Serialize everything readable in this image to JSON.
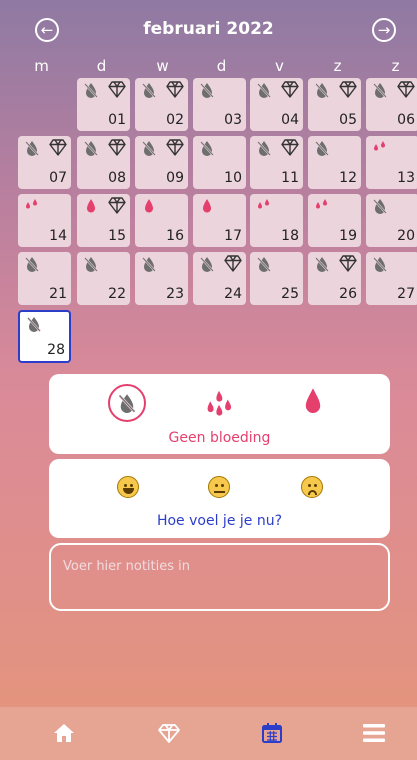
{
  "header": {
    "title": "februari 2022"
  },
  "weekdays": [
    "m",
    "d",
    "w",
    "d",
    "v",
    "z",
    "z"
  ],
  "cells": [
    {
      "day": "01",
      "b": "none",
      "d": true
    },
    {
      "day": "02",
      "b": "none",
      "d": true
    },
    {
      "day": "03",
      "b": "none",
      "d": false
    },
    {
      "day": "04",
      "b": "none",
      "d": true
    },
    {
      "day": "05",
      "b": "none",
      "d": true
    },
    {
      "day": "06",
      "b": "none",
      "d": true
    },
    {
      "day": "07",
      "b": "none",
      "d": true
    },
    {
      "day": "08",
      "b": "none",
      "d": true
    },
    {
      "day": "09",
      "b": "none",
      "d": true
    },
    {
      "day": "10",
      "b": "none",
      "d": false
    },
    {
      "day": "11",
      "b": "none",
      "d": true
    },
    {
      "day": "12",
      "b": "none",
      "d": false
    },
    {
      "day": "13",
      "b": "light",
      "d": false
    },
    {
      "day": "14",
      "b": "light",
      "d": false
    },
    {
      "day": "15",
      "b": "heavy",
      "d": true
    },
    {
      "day": "16",
      "b": "heavy",
      "d": false
    },
    {
      "day": "17",
      "b": "heavy",
      "d": false
    },
    {
      "day": "18",
      "b": "light",
      "d": false
    },
    {
      "day": "19",
      "b": "light",
      "d": false
    },
    {
      "day": "20",
      "b": "none",
      "d": false
    },
    {
      "day": "21",
      "b": "none",
      "d": false
    },
    {
      "day": "22",
      "b": "none",
      "d": false
    },
    {
      "day": "23",
      "b": "none",
      "d": false
    },
    {
      "day": "24",
      "b": "none",
      "d": true
    },
    {
      "day": "25",
      "b": "none",
      "d": false
    },
    {
      "day": "26",
      "b": "none",
      "d": true
    },
    {
      "day": "27",
      "b": "none",
      "d": false
    },
    {
      "day": "28",
      "b": "none",
      "d": false
    }
  ],
  "selected_day": "28",
  "bleeding": {
    "label": "Geen bloeding",
    "selected": "none"
  },
  "mood": {
    "label": "Hoe voel je je nu?",
    "options": [
      "happy",
      "neutral",
      "sad"
    ]
  },
  "notes": {
    "placeholder": "Voer hier notities in"
  },
  "tabs": [
    {
      "icon": "home-icon"
    },
    {
      "icon": "diamond-icon"
    },
    {
      "icon": "calendar-icon",
      "active": true
    },
    {
      "icon": "menu-icon"
    }
  ],
  "colors": {
    "accent": "#e53f6e",
    "selected_border": "#2b3dc9",
    "cell_bg": "#ebd4dc",
    "tab_active": "#2b3dc9"
  }
}
